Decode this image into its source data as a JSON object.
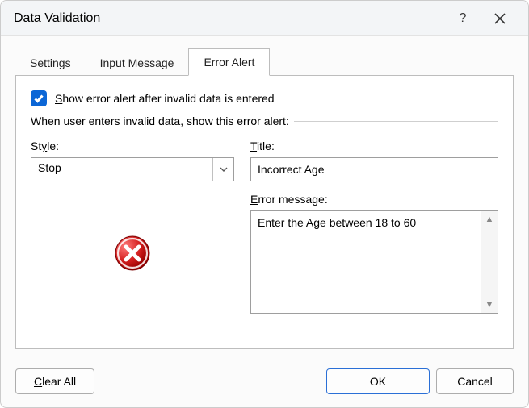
{
  "titlebar": {
    "title": "Data Validation",
    "help_symbol": "?",
    "close_label": "Close"
  },
  "tabs": {
    "settings": "Settings",
    "input_message": "Input Message",
    "error_alert": "Error Alert",
    "active": "error_alert"
  },
  "checkbox": {
    "checked": true,
    "label_prefix_ul": "S",
    "label_rest": "how error alert after invalid data is entered"
  },
  "fieldset": {
    "legend": "When user enters invalid data, show this error alert:"
  },
  "style": {
    "label_prefix": "St",
    "label_ul": "y",
    "label_suffix": "le:",
    "value": "Stop"
  },
  "title_field": {
    "label_ul": "T",
    "label_rest": "itle:",
    "value": "Incorrect Age"
  },
  "error_message": {
    "label_ul": "E",
    "label_rest": "rror message:",
    "value": "Enter the Age between 18 to 60"
  },
  "footer": {
    "clear_ul": "C",
    "clear_rest": "lear All",
    "ok": "OK",
    "cancel": "Cancel"
  }
}
